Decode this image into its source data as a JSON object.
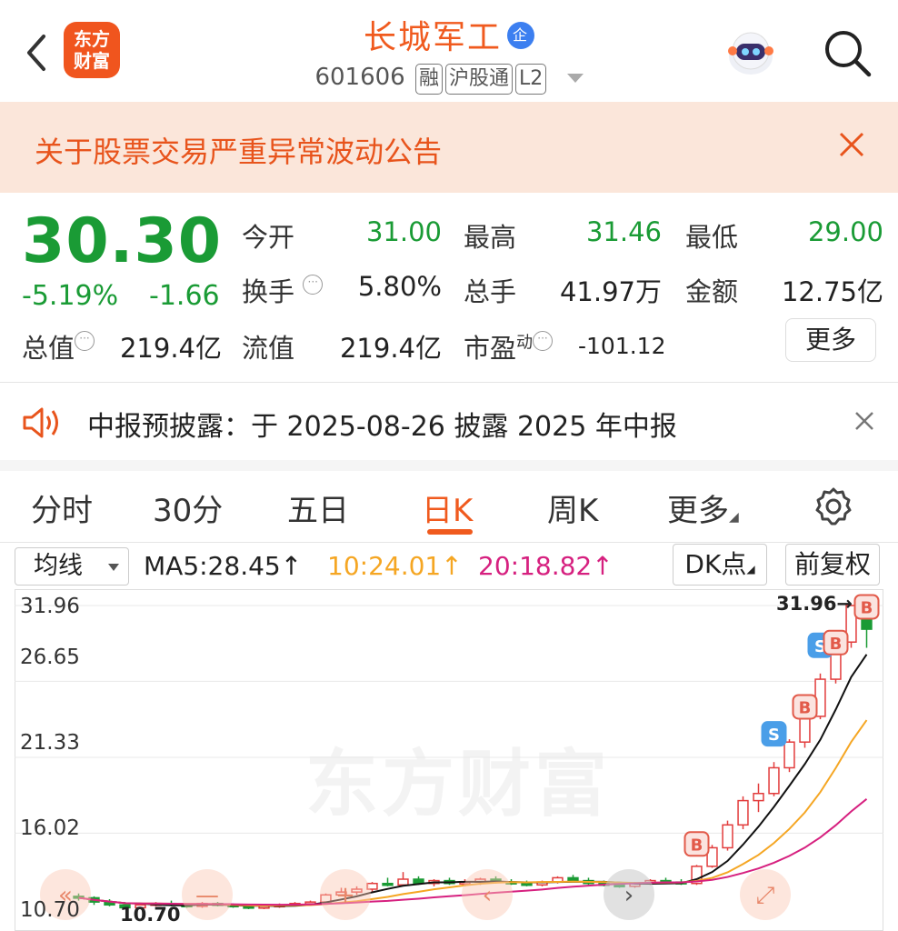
{
  "header": {
    "logo_line1": "东方",
    "logo_line2": "财富",
    "stock_name": "长城军工",
    "ent_badge": "企",
    "code": "601606",
    "tags": [
      "融",
      "沪股通",
      "L2"
    ]
  },
  "banner": {
    "text": "关于股票交易严重异常波动公告"
  },
  "quote": {
    "price": "30.30",
    "change_pct": "-5.19%",
    "change": "-1.66",
    "open_label": "今开",
    "open": "31.00",
    "high_label": "最高",
    "high": "31.46",
    "low_label": "最低",
    "low": "29.00",
    "turnover_label": "换手",
    "turnover": "5.80%",
    "volume_label": "总手",
    "volume": "41.97万",
    "amount_label": "金额",
    "amount": "12.75亿",
    "mktcap_label": "总值",
    "mktcap": "219.4亿",
    "float_label": "流值",
    "float": "219.4亿",
    "pe_label": "市盈",
    "pe_sup": "动",
    "pe": "-101.12",
    "more_label": "更多"
  },
  "notice": {
    "text": "中报预披露：于 2025-08-26 披露 2025 年中报"
  },
  "tabs": [
    "分时",
    "30分",
    "五日",
    "日K",
    "周K",
    "更多"
  ],
  "active_tab": "日K",
  "ma_row": {
    "selector": "均线",
    "ma5": "MA5:28.45↑",
    "ma10": "10:24.01↑",
    "ma20": "20:18.82↑",
    "dk_label": "DK点",
    "adjust_label": "前复权"
  },
  "colors": {
    "brand": "#f05a1e",
    "down": "#1a9b35",
    "up": "#e23c3c",
    "ma10": "#f5a623",
    "ma20": "#d6207f"
  },
  "chart_data": {
    "type": "candlestick",
    "y_ticks": [
      "31.96",
      "26.65",
      "21.33",
      "16.02",
      "10.70"
    ],
    "ylim": [
      10.7,
      31.96
    ],
    "max_marker": "31.96→",
    "min_marker": "10.70",
    "watermark": "东方财富",
    "signals": [
      "B",
      "S",
      "B",
      "S",
      "B",
      "B"
    ],
    "candles_ohlc": [
      [
        11.6,
        11.8,
        11.3,
        11.5
      ],
      [
        11.5,
        11.6,
        11.0,
        11.2
      ],
      [
        11.2,
        11.4,
        10.9,
        11.0
      ],
      [
        11.0,
        11.2,
        10.7,
        10.8
      ],
      [
        10.8,
        11.1,
        10.7,
        11.0
      ],
      [
        11.0,
        11.2,
        10.9,
        11.1
      ],
      [
        11.1,
        11.3,
        10.9,
        11.0
      ],
      [
        11.0,
        11.1,
        10.8,
        10.9
      ],
      [
        10.9,
        11.2,
        10.8,
        11.1
      ],
      [
        11.1,
        11.2,
        10.9,
        11.0
      ],
      [
        11.0,
        11.1,
        10.8,
        10.9
      ],
      [
        10.9,
        11.0,
        10.7,
        10.8
      ],
      [
        10.8,
        11.0,
        10.7,
        10.9
      ],
      [
        10.9,
        11.1,
        10.8,
        11.0
      ],
      [
        11.0,
        11.2,
        10.9,
        11.1
      ],
      [
        11.1,
        11.3,
        11.0,
        11.2
      ],
      [
        11.2,
        11.8,
        11.1,
        11.7
      ],
      [
        11.7,
        12.2,
        11.6,
        11.9
      ],
      [
        11.9,
        12.3,
        11.7,
        12.1
      ],
      [
        12.1,
        12.6,
        11.9,
        12.5
      ],
      [
        12.5,
        12.9,
        12.3,
        12.4
      ],
      [
        12.4,
        13.3,
        12.3,
        12.8
      ],
      [
        12.8,
        13.0,
        12.4,
        12.5
      ],
      [
        12.5,
        12.8,
        12.3,
        12.7
      ],
      [
        12.7,
        12.9,
        12.4,
        12.5
      ],
      [
        12.5,
        12.8,
        12.3,
        12.6
      ],
      [
        12.6,
        12.9,
        12.4,
        12.8
      ],
      [
        12.8,
        13.0,
        12.5,
        12.6
      ],
      [
        12.6,
        12.8,
        12.4,
        12.5
      ],
      [
        12.5,
        12.7,
        12.3,
        12.4
      ],
      [
        12.4,
        12.7,
        12.3,
        12.6
      ],
      [
        12.6,
        13.0,
        12.5,
        12.9
      ],
      [
        12.9,
        13.1,
        12.6,
        12.7
      ],
      [
        12.7,
        12.9,
        12.4,
        12.5
      ],
      [
        12.5,
        12.7,
        12.3,
        12.4
      ],
      [
        12.4,
        12.6,
        12.2,
        12.3
      ],
      [
        12.3,
        12.6,
        12.2,
        12.5
      ],
      [
        12.5,
        12.8,
        12.4,
        12.7
      ],
      [
        12.7,
        12.9,
        12.5,
        12.6
      ],
      [
        12.6,
        12.8,
        12.4,
        12.5
      ],
      [
        12.5,
        13.8,
        12.4,
        13.7
      ],
      [
        13.7,
        15.2,
        13.6,
        15.0
      ],
      [
        15.0,
        16.9,
        14.8,
        16.6
      ],
      [
        16.6,
        18.6,
        16.3,
        18.3
      ],
      [
        18.3,
        19.5,
        17.5,
        18.8
      ],
      [
        18.8,
        21.0,
        18.6,
        20.6
      ],
      [
        20.6,
        22.6,
        20.3,
        22.4
      ],
      [
        22.4,
        24.6,
        22.0,
        24.2
      ],
      [
        24.2,
        27.2,
        24.0,
        26.8
      ],
      [
        26.8,
        29.7,
        26.5,
        29.4
      ],
      [
        29.4,
        31.96,
        29.0,
        31.96
      ],
      [
        31.0,
        31.46,
        29.0,
        30.3
      ]
    ]
  }
}
